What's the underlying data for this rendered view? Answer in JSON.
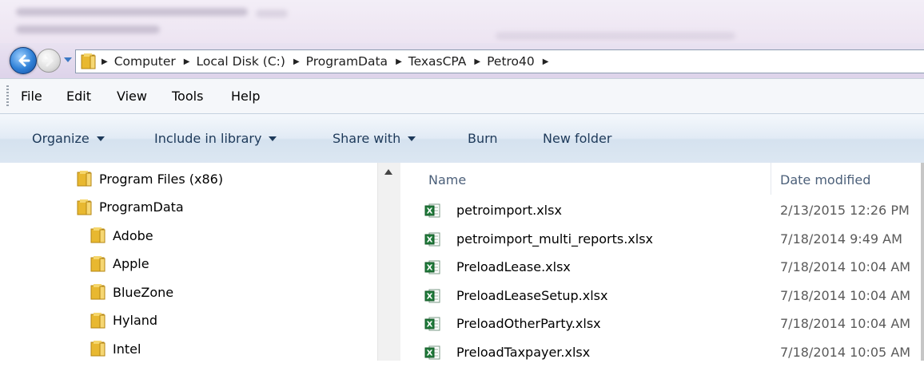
{
  "address": {
    "breadcrumbs": [
      "Computer",
      "Local Disk (C:)",
      "ProgramData",
      "TexasCPA",
      "Petro40"
    ]
  },
  "menu": [
    "File",
    "Edit",
    "View",
    "Tools",
    "Help"
  ],
  "commands": {
    "organize": "Organize",
    "include_in_library": "Include in library",
    "share_with": "Share with",
    "burn": "Burn",
    "new_folder": "New folder"
  },
  "nav_tree": [
    {
      "label": "Program Files (x86)"
    },
    {
      "label": "ProgramData"
    },
    {
      "label": "Adobe"
    },
    {
      "label": "Apple"
    },
    {
      "label": "BlueZone"
    },
    {
      "label": "Hyland"
    },
    {
      "label": "Intel"
    }
  ],
  "columns": {
    "name": "Name",
    "date_modified": "Date modified"
  },
  "files": [
    {
      "name": "petroimport.xlsx",
      "date": "2/13/2015 12:26 PM"
    },
    {
      "name": "petroimport_multi_reports.xlsx",
      "date": "7/18/2014 9:49 AM"
    },
    {
      "name": "PreloadLease.xlsx",
      "date": "7/18/2014 10:04 AM"
    },
    {
      "name": "PreloadLeaseSetup.xlsx",
      "date": "7/18/2014 10:04 AM"
    },
    {
      "name": "PreloadOtherParty.xlsx",
      "date": "7/18/2014 10:04 AM"
    },
    {
      "name": "PreloadTaxpayer.xlsx",
      "date": "7/18/2014 10:05 AM"
    }
  ],
  "icons": {
    "folder": "folder-icon",
    "excel": "excel-file-icon",
    "back": "back-arrow-icon",
    "forward": "forward-arrow-icon"
  },
  "colors": {
    "accent": "#1e3a5a",
    "folder": "#e8b830",
    "excel": "#1f7a3a"
  }
}
